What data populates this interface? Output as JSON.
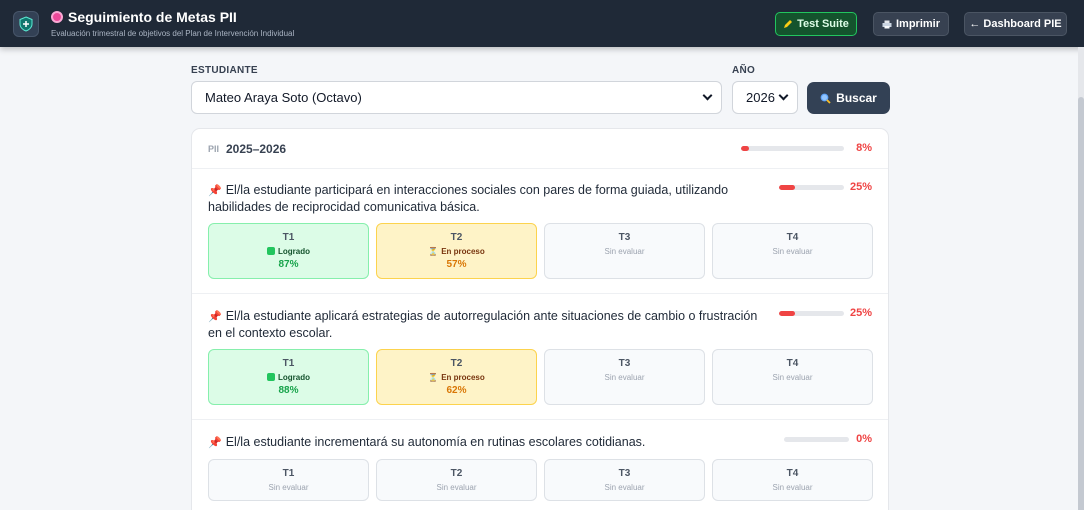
{
  "header": {
    "title": "Seguimiento de Metas PII",
    "subtitle": "Evaluación trimestral de objetivos del Plan de Intervención Individual",
    "buttons": {
      "test": "Test Suite",
      "print": "Imprimir",
      "dashboard": "← Dashboard PIE"
    },
    "icons": {
      "logo": "shield-icon",
      "title": "target-icon",
      "test": "pencil-icon",
      "print": "printer-icon",
      "search": "magnifier-icon"
    }
  },
  "filters": {
    "student_label": "ESTUDIANTE",
    "student_value": "Mateo Araya Soto (Octavo)",
    "year_label": "AÑO",
    "year_value": "2026",
    "search_label": "Buscar"
  },
  "plan": {
    "tag": "PII",
    "period": "2025–2026",
    "progress_text": "8%",
    "progress": 0.08
  },
  "colors": {
    "achieved": "#22c55e",
    "in_progress": "#f59e0b",
    "danger": "#ef4444",
    "header": "#1f2937"
  },
  "goals": [
    {
      "text": "El/la estudiante participará en interacciones sociales con pares de forma guiada, utilizando habilidades de reciprocidad comunicativa básica.",
      "progress_text": "25%",
      "progress": 0.25,
      "quarters": [
        {
          "name": "T1",
          "status": "Logrado",
          "value": "87%"
        },
        {
          "name": "T2",
          "status": "En proceso",
          "value": "57%"
        },
        {
          "name": "T3",
          "status": "Sin evaluar",
          "value": ""
        },
        {
          "name": "T4",
          "status": "Sin evaluar",
          "value": ""
        }
      ]
    },
    {
      "text": "El/la estudiante aplicará estrategias de autorregulación ante situaciones de cambio o frustración en el contexto escolar.",
      "progress_text": "25%",
      "progress": 0.25,
      "quarters": [
        {
          "name": "T1",
          "status": "Logrado",
          "value": "88%"
        },
        {
          "name": "T2",
          "status": "En proceso",
          "value": "62%"
        },
        {
          "name": "T3",
          "status": "Sin evaluar",
          "value": ""
        },
        {
          "name": "T4",
          "status": "Sin evaluar",
          "value": ""
        }
      ]
    },
    {
      "text": "El/la estudiante incrementará su autonomía en rutinas escolares cotidianas.",
      "progress_text": "0%",
      "progress": 0,
      "quarters": [
        {
          "name": "T1",
          "status": "Sin evaluar",
          "value": ""
        },
        {
          "name": "T2",
          "status": "Sin evaluar",
          "value": ""
        },
        {
          "name": "T3",
          "status": "Sin evaluar",
          "value": ""
        },
        {
          "name": "T4",
          "status": "Sin evaluar",
          "value": ""
        }
      ]
    }
  ]
}
